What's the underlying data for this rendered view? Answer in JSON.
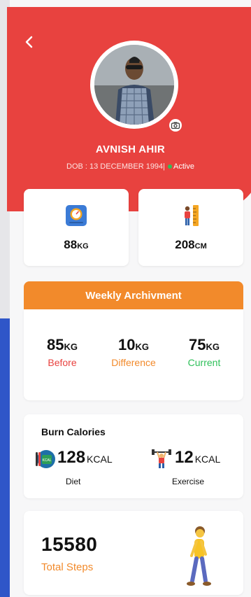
{
  "profile": {
    "name": "AVNISH AHIR",
    "dob": "DOB : 13 DECEMBER 1994",
    "separator": "|",
    "status": "Active"
  },
  "metrics": {
    "weight": {
      "value": "88",
      "unit": "KG",
      "icon": "weighing-scale-icon"
    },
    "height": {
      "value": "208",
      "unit": "CM",
      "icon": "height-measure-icon"
    }
  },
  "weekly": {
    "title": "Weekly Archivment",
    "before": {
      "value": "85",
      "unit": "KG",
      "label": "Before"
    },
    "difference": {
      "value": "10",
      "unit": "KG",
      "label": "Difference"
    },
    "current": {
      "value": "75",
      "unit": "KG",
      "label": "Current"
    }
  },
  "burn": {
    "title": "Burn Calories",
    "diet": {
      "value": "128",
      "unit": "KCAL",
      "label": "Diet"
    },
    "exercise": {
      "value": "12",
      "unit": "KCAL",
      "label": "Exercise"
    }
  },
  "steps": {
    "value": "15580",
    "label": "Total Steps"
  },
  "colors": {
    "header": "#e8423f",
    "accent": "#f28a2b",
    "before": "#e8423f",
    "difference": "#f28a2b",
    "current": "#2fc05a",
    "active_dot": "#2fc05a"
  }
}
